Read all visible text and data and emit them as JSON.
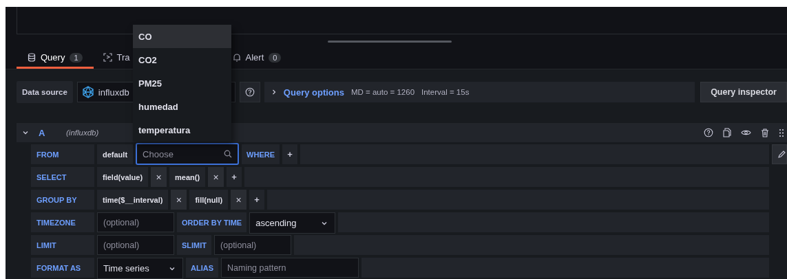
{
  "tabs": [
    {
      "kind": "query",
      "label": "Query",
      "count": "1",
      "selected": true
    },
    {
      "kind": "transform",
      "label": "Tra",
      "selected": false
    },
    {
      "kind": "alert",
      "label": "Alert",
      "count": "0",
      "selected": false
    }
  ],
  "data_source": {
    "label": "Data source",
    "value": "influxdb"
  },
  "query_options": {
    "label": "Query options",
    "md": "MD = auto = 1260",
    "interval": "Interval = 15s"
  },
  "query_inspector": "Query inspector",
  "query": {
    "ref": "A",
    "datasource": "(influxdb)",
    "expanded": true,
    "rows": [
      {
        "label": "FROM",
        "parts": [
          {
            "kind": "segment",
            "text": "default"
          },
          {
            "kind": "search",
            "placeholder": "Choose",
            "focused": true
          },
          {
            "kind": "keyword",
            "text": "WHERE"
          },
          {
            "kind": "add",
            "text": "+"
          }
        ]
      },
      {
        "label": "SELECT",
        "parts": [
          {
            "kind": "segment",
            "text": "field(value)"
          },
          {
            "kind": "remove",
            "text": "×"
          },
          {
            "kind": "segment",
            "text": "mean()"
          },
          {
            "kind": "remove",
            "text": "×"
          },
          {
            "kind": "add",
            "text": "+"
          }
        ]
      },
      {
        "label": "GROUP BY",
        "parts": [
          {
            "kind": "segment",
            "text": "time($__interval)"
          },
          {
            "kind": "remove",
            "text": "×"
          },
          {
            "kind": "segment",
            "text": "fill(null)"
          },
          {
            "kind": "remove",
            "text": "×"
          },
          {
            "kind": "add",
            "text": "+"
          }
        ]
      },
      {
        "label": "TIMEZONE",
        "parts": [
          {
            "kind": "input",
            "placeholder": "(optional)"
          },
          {
            "kind": "keyword",
            "text": "ORDER BY TIME"
          },
          {
            "kind": "select",
            "value": "ascending"
          }
        ]
      },
      {
        "label": "LIMIT",
        "parts": [
          {
            "kind": "input",
            "placeholder": "(optional)"
          },
          {
            "kind": "keyword",
            "text": "SLIMIT"
          },
          {
            "kind": "input",
            "placeholder": "(optional)"
          }
        ]
      },
      {
        "label": "FORMAT AS",
        "parts": [
          {
            "kind": "select",
            "value": "Time series"
          },
          {
            "kind": "keyword",
            "text": "ALIAS"
          },
          {
            "kind": "wide-input",
            "placeholder": "Naming pattern"
          }
        ]
      }
    ]
  },
  "dropdown": {
    "options": [
      {
        "label": "CO",
        "selected": true
      },
      {
        "label": "CO2",
        "selected": false
      },
      {
        "label": "PM25",
        "selected": false
      },
      {
        "label": "humedad",
        "selected": false
      },
      {
        "label": "temperatura",
        "selected": false
      }
    ]
  }
}
